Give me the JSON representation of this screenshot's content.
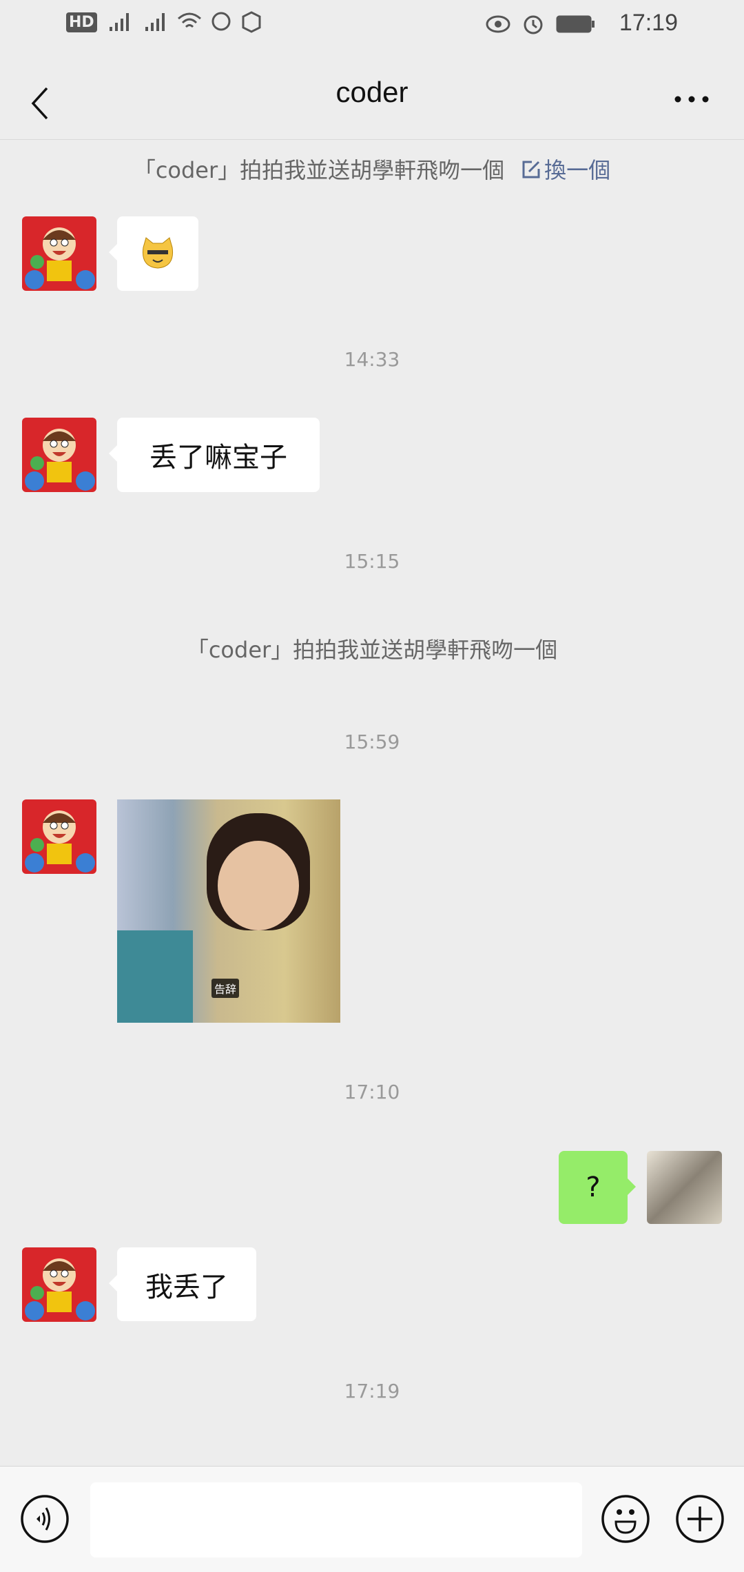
{
  "status_bar": {
    "time": "17:19",
    "left_icons": [
      "hd-icon",
      "signal-4g-icon",
      "signal-5g-icon",
      "wifi-icon",
      "whatsapp-icon",
      "hand-icon"
    ],
    "right_icons": [
      "eye-icon",
      "alarm-icon",
      "battery-icon"
    ]
  },
  "nav": {
    "title": "coder",
    "back_icon": "chevron-left-icon",
    "more_icon": "more-icon"
  },
  "messages": {
    "pat1": "「coder」拍拍我並送胡學軒飛吻一個",
    "pat1_action": "換一個",
    "ts1": "14:33",
    "msg1": "丢了嘛宝子",
    "ts2": "15:15",
    "pat2": "「coder」拍拍我並送胡學軒飛吻一個",
    "ts3": "15:59",
    "image_caption": "告辞",
    "ts4": "17:10",
    "my_msg": "?",
    "msg2": "我丢了",
    "ts5": "17:19"
  },
  "bottom_bar": {
    "voice_icon": "voice-icon",
    "emoji_icon": "emoji-icon",
    "plus_icon": "plus-icon",
    "input_value": ""
  },
  "colors": {
    "background": "#ededed",
    "my_bubble": "#95ec69",
    "link": "#576b95"
  }
}
